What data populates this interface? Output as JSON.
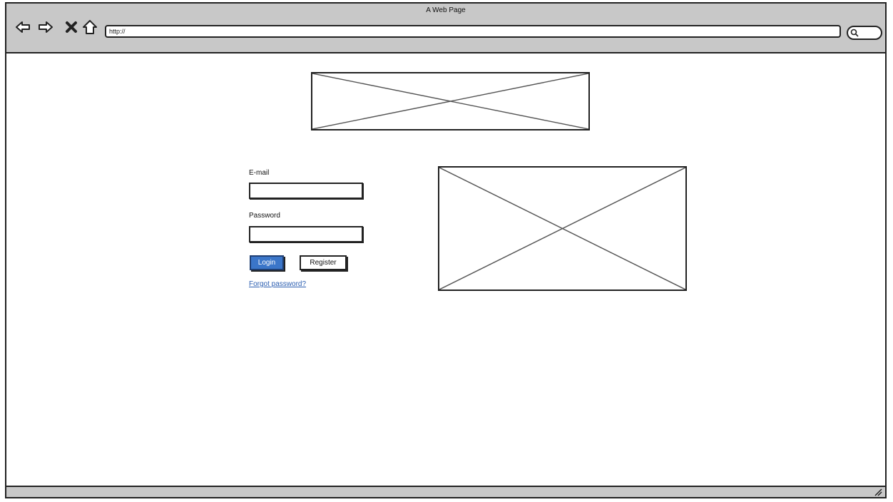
{
  "window": {
    "title": "A Web Page",
    "url": "http://",
    "nav_icons": [
      "back-arrow-icon",
      "forward-arrow-icon",
      "stop-icon",
      "home-icon"
    ],
    "search_icon": "search-icon"
  },
  "login_form": {
    "email_label": "E-mail",
    "email_value": "",
    "password_label": "Password",
    "password_value": "",
    "login_button": "Login",
    "register_button": "Register",
    "forgot_link": "Forgot password?"
  },
  "colors": {
    "chrome": "#c8c8c8",
    "primary_button": "#3b76c9",
    "link": "#2a5db0"
  }
}
